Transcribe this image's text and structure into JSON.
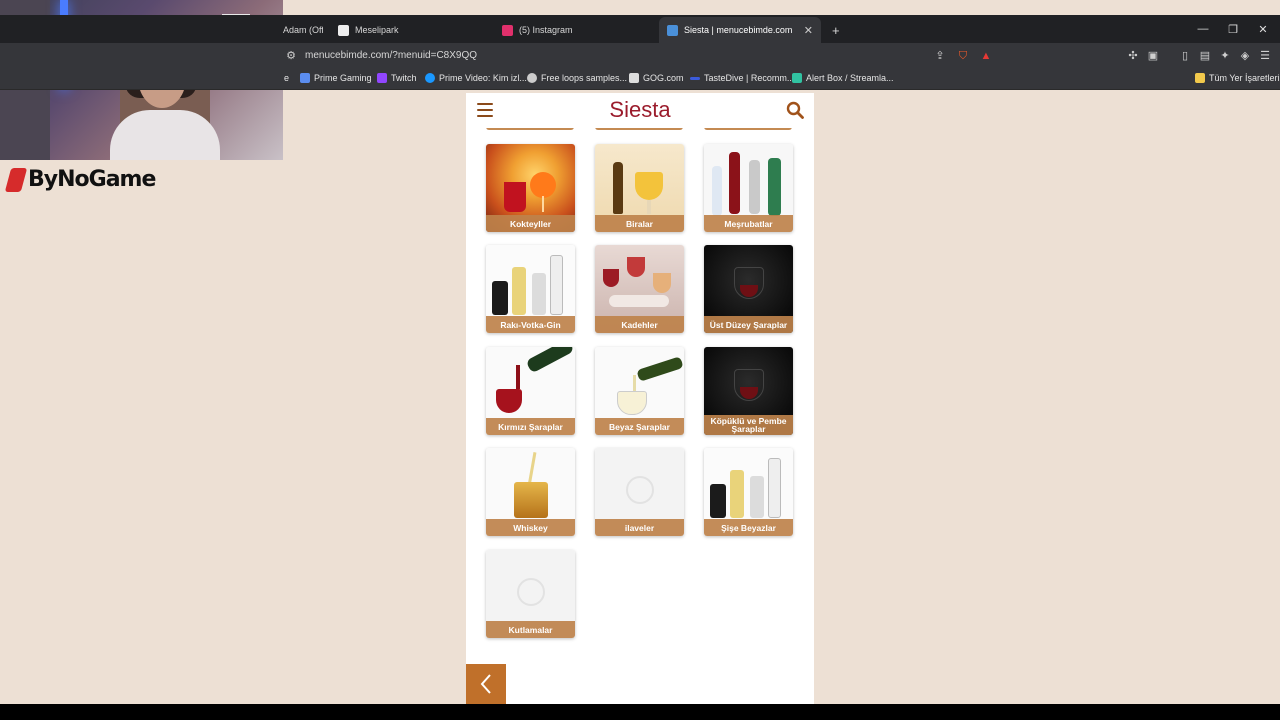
{
  "browser": {
    "tabs": [
      {
        "title": "Adam (Offi",
        "favicon_color": "#c00"
      },
      {
        "title": "Meselipark",
        "favicon_color": "#eee"
      },
      {
        "title": "(5) Instagram",
        "favicon_color": "#e1306c"
      },
      {
        "title": "Siesta | menucebimde.com",
        "favicon_color": "#4a90d9",
        "active": true
      }
    ],
    "new_tab_label": "+",
    "url": "menucebimde.com/?menuid=C8X9QQ",
    "bookmarks": [
      {
        "label": "Prime Gaming",
        "color": "#5b8def"
      },
      {
        "label": "Twitch",
        "color": "#9146ff"
      },
      {
        "label": "Prime Video: Kim izl...",
        "color": "#1a98ff"
      },
      {
        "label": "Free loops samples...",
        "color": "#cccccc"
      },
      {
        "label": "GOG.com",
        "color": "#dddddd"
      },
      {
        "label": "TasteDive | Recomm...",
        "color": "#3b5bdb"
      },
      {
        "label": "Alert Box / Streamla...",
        "color": "#31c3a2"
      }
    ],
    "other_bookmarks": "Tüm Yer İşaretleri"
  },
  "overlay": {
    "brand": "ByNoGame"
  },
  "site": {
    "logo": "Siesta",
    "categories": [
      {
        "label": "Kokteyller",
        "art": "cocktail"
      },
      {
        "label": "Biralar",
        "art": "beer"
      },
      {
        "label": "Meşrubatlar",
        "art": "soda"
      },
      {
        "label": "Rakı-Votka-Gin",
        "art": "spirits"
      },
      {
        "label": "Kadehler",
        "art": "glasses"
      },
      {
        "label": "Üst Düzey Şaraplar",
        "art": "dark-wine"
      },
      {
        "label": "Kırmızı Şaraplar",
        "art": "red-wine"
      },
      {
        "label": "Beyaz Şaraplar",
        "art": "white-wine"
      },
      {
        "label": "Köpüklü ve Pembe Şaraplar",
        "art": "dark-wine"
      },
      {
        "label": "Whiskey",
        "art": "whiskey"
      },
      {
        "label": "ilaveler",
        "art": "placeholder"
      },
      {
        "label": "Şişe Beyazlar",
        "art": "spirits"
      },
      {
        "label": "Kutlamalar",
        "art": "placeholder"
      }
    ]
  }
}
